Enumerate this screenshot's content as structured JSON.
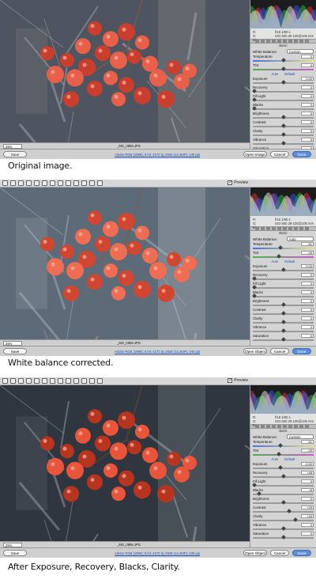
{
  "captions": [
    "Original image.",
    "White balance corrected.",
    "After Exposure, Recovery, Blacks, Clarity."
  ],
  "common": {
    "preview_label": "Preview",
    "basic_label": "Basic",
    "wb_label": "White Balance:",
    "auto_label": "Auto",
    "default_label": "Default",
    "save_label": "Save Image...",
    "open_label": "Open Image",
    "open_object_label": "Open Object",
    "cancel_label": "Cancel",
    "done_label": "Done",
    "filename": "_MG_0959.JPG",
    "workflow_link": "Adobe RGB (1998); 8 bit; 4272 by 2848 (12.2MP); 240 ppi",
    "zoom": "25%",
    "meta_left": [
      "R:",
      "G:",
      "B:"
    ],
    "meta_right": [
      "f/18 1/80 s",
      "ISO 800 28-105@105 mm"
    ],
    "slider_labels": [
      "Temperature",
      "Tint",
      "Exposure",
      "Recovery",
      "Fill Light",
      "Blacks",
      "Brightness",
      "Contrast",
      "Clarity",
      "Vibrance",
      "Saturation"
    ]
  },
  "panels": [
    {
      "wb_value": "Custom",
      "open_button": "Open Image",
      "values": [
        "0",
        "0",
        "0.00",
        "0",
        "0",
        "0",
        "0",
        "0",
        "0",
        "0",
        "0"
      ],
      "positions": [
        0.5,
        0.5,
        0.5,
        0.0,
        0.0,
        0.0,
        0.5,
        0.5,
        0.5,
        0.5,
        0.5
      ]
    },
    {
      "wb_value": "Auto",
      "open_button": "Open Object",
      "values": [
        "-51",
        "-25",
        "0.00",
        "0",
        "0",
        "0",
        "0",
        "0",
        "0",
        "0",
        "0"
      ],
      "positions": [
        0.44,
        0.42,
        0.5,
        0.0,
        0.0,
        0.0,
        0.5,
        0.5,
        0.5,
        0.5,
        0.5
      ]
    },
    {
      "wb_value": "Custom",
      "open_button": "Open Object",
      "values": [
        "-51",
        "-25",
        "-0.60",
        "+48",
        "0",
        "+8",
        "0",
        "+25",
        "+40",
        "0",
        "0"
      ],
      "positions": [
        0.44,
        0.42,
        0.45,
        0.5,
        0.0,
        0.08,
        0.5,
        0.6,
        0.7,
        0.5,
        0.5
      ]
    }
  ]
}
